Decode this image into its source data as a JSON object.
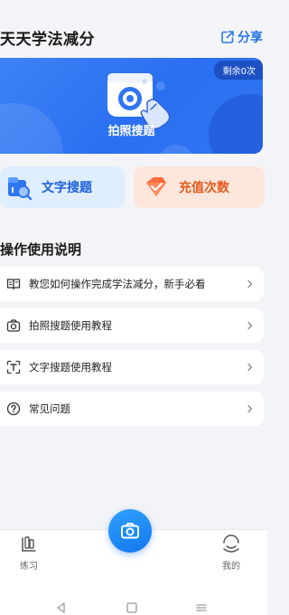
{
  "header": {
    "title": "天天学法减分",
    "share_label": "分享",
    "share_icon": "share-icon"
  },
  "banner": {
    "remaining_badge": "剩余0次",
    "label": "拍照搜题",
    "illustration": "camera-tap-icon"
  },
  "quick_actions": [
    {
      "label": "文字搜题",
      "icon": "text-search-icon",
      "color": "#1a5fd8"
    },
    {
      "label": "充值次数",
      "icon": "recharge-icon",
      "color": "#e45a1e"
    }
  ],
  "guide": {
    "section_title": "操作使用说明",
    "items": [
      {
        "label": "教您如何操作完成学法减分，新手必看",
        "icon": "book-icon"
      },
      {
        "label": "拍照搜题使用教程",
        "icon": "camera-icon"
      },
      {
        "label": "文字搜题使用教程",
        "icon": "text-scan-icon"
      },
      {
        "label": "常见问题",
        "icon": "question-icon"
      }
    ]
  },
  "bottom_nav": {
    "practice_label": "练习",
    "mine_label": "我的",
    "center_icon": "camera-icon"
  },
  "colors": {
    "accent": "#2477e6",
    "banner": "#2f76f2",
    "recharge": "#e45a1e"
  }
}
